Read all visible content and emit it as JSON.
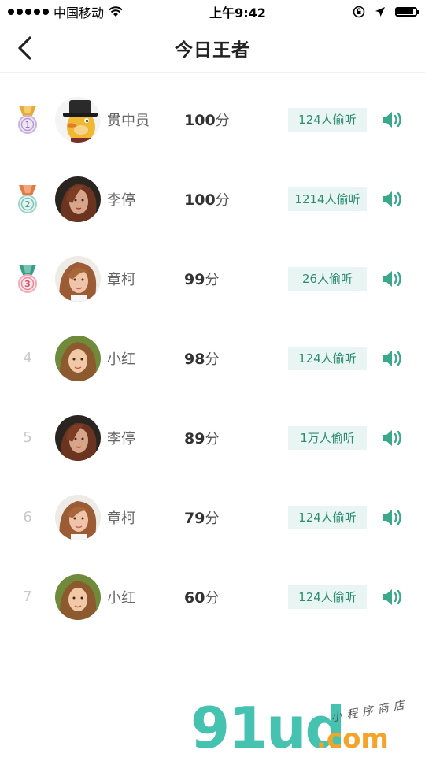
{
  "status": {
    "carrier": "中国移动",
    "time": "上午9:42"
  },
  "nav": {
    "title": "今日王者"
  },
  "rows": [
    {
      "rank": "1",
      "name": "贯中员",
      "score": "100",
      "unit": "分",
      "listen": "124人偷听",
      "medal_color": "#f1c84b",
      "ribbon": "#e7a93a",
      "avatar": "cartoon-hat"
    },
    {
      "rank": "2",
      "name": "李停",
      "score": "100",
      "unit": "分",
      "listen": "1214人偷听",
      "medal_color": "#9ed4c9",
      "ribbon": "#e27a45",
      "avatar": "woman-dark"
    },
    {
      "rank": "3",
      "name": "章柯",
      "score": "99",
      "unit": "分",
      "listen": "26人偷听",
      "medal_color": "#f4a9b6",
      "ribbon": "#3b9e8a",
      "avatar": "woman-light"
    },
    {
      "rank": "4",
      "name": "小红",
      "score": "98",
      "unit": "分",
      "listen": "124人偷听",
      "avatar": "woman-green"
    },
    {
      "rank": "5",
      "name": "李停",
      "score": "89",
      "unit": "分",
      "listen": "1万人偷听",
      "avatar": "woman-dark"
    },
    {
      "rank": "6",
      "name": "章柯",
      "score": "79",
      "unit": "分",
      "listen": "124人偷听",
      "avatar": "woman-light"
    },
    {
      "rank": "7",
      "name": "小红",
      "score": "60",
      "unit": "分",
      "listen": "124人偷听",
      "avatar": "woman-green"
    }
  ],
  "watermark": {
    "brand": "91ud",
    "domain": ".com",
    "tagline": "小程序商店"
  },
  "colors": {
    "accent": "#2f8c73",
    "listen_bg": "#e8f5f2",
    "rank_gray": "#c9c9c9"
  }
}
